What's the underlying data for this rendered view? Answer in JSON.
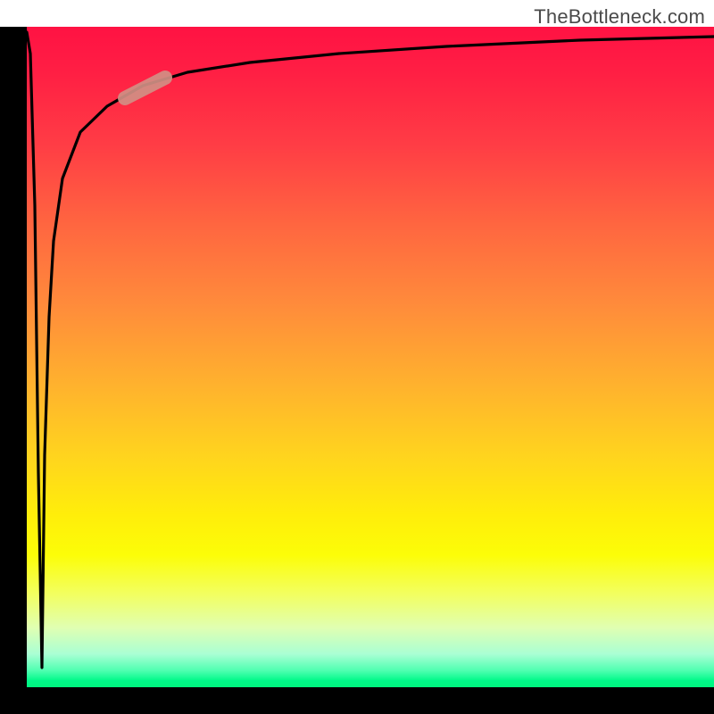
{
  "attribution": "TheBottleneck.com",
  "colors": {
    "frame": "#000000",
    "curve": "#000000",
    "highlight": "#d18f84",
    "gradient_top": "#ff1243",
    "gradient_bottom": "#00f57f"
  },
  "chart_data": {
    "type": "line",
    "title": "",
    "xlabel": "",
    "ylabel": "",
    "xlim": [
      0,
      100
    ],
    "ylim": [
      0,
      100
    ],
    "grid": false,
    "legend": false,
    "note": "Axes are unlabeled; values below are estimated from pixel positions on a 0–100 normalized scale (origin at bottom-left of the colored plot area). Background vertical gradient runs from red (top, high y) through orange/yellow to green (bottom, low y).",
    "series": [
      {
        "name": "curve",
        "description": "Starts near top-left, plunges to the bottom almost immediately, then rises steeply and asymptotically approaches the top toward the right edge.",
        "x": [
          0.0,
          1.2,
          2.2,
          2.6,
          3.2,
          3.9,
          5.2,
          7.8,
          11.7,
          16.9,
          23.4,
          32.5,
          45.5,
          61.0,
          80.5,
          100.0
        ],
        "y": [
          99.0,
          60.0,
          3.0,
          35.0,
          56.0,
          67.5,
          77.0,
          84.0,
          88.0,
          91.0,
          93.0,
          94.5,
          96.0,
          97.0,
          97.8,
          98.3
        ]
      }
    ],
    "highlight_segment": {
      "description": "Short thick rounded stroke on the curve near the upper-left bend",
      "x_range": [
        14.3,
        20.1
      ],
      "y_range": [
        89.2,
        92.3
      ]
    }
  }
}
